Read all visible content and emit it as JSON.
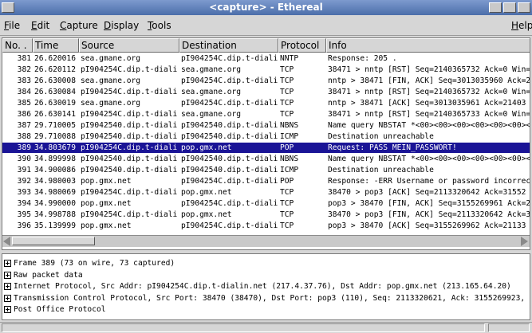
{
  "window": {
    "title": "<capture> - Ethereal"
  },
  "menubar": {
    "items": [
      {
        "pre": "",
        "ul": "F",
        "post": "ile"
      },
      {
        "pre": "",
        "ul": "E",
        "post": "dit"
      },
      {
        "pre": "",
        "ul": "C",
        "post": "apture"
      },
      {
        "pre": "",
        "ul": "D",
        "post": "isplay"
      },
      {
        "pre": "",
        "ul": "T",
        "post": "ools"
      }
    ],
    "help": {
      "pre": "",
      "ul": "H",
      "post": "elp"
    }
  },
  "packet_list": {
    "columns": [
      "No. .",
      "Time",
      "Source",
      "Destination",
      "Protocol",
      "Info"
    ],
    "rows": [
      [
        "381",
        "26.620016",
        "sea.gmane.org",
        "pI904254C.dip.t-diali",
        "NNTP",
        "Response: 205 ."
      ],
      [
        "382",
        "26.620112",
        "pI904254C.dip.t-diali",
        "sea.gmane.org",
        "TCP",
        "38471 > nntp [RST] Seq=2140365732 Ack=0 Win="
      ],
      [
        "383",
        "26.630008",
        "sea.gmane.org",
        "pI904254C.dip.t-diali",
        "TCP",
        "nntp > 38471 [FIN, ACK] Seq=3013035960 Ack=2"
      ],
      [
        "384",
        "26.630084",
        "pI904254C.dip.t-diali",
        "sea.gmane.org",
        "TCP",
        "38471 > nntp [RST] Seq=2140365732 Ack=0 Win="
      ],
      [
        "385",
        "26.630019",
        "sea.gmane.org",
        "pI904254C.dip.t-diali",
        "TCP",
        "nntp > 38471 [ACK] Seq=3013035961 Ack=21403"
      ],
      [
        "386",
        "26.630141",
        "pI904254C.dip.t-diali",
        "sea.gmane.org",
        "TCP",
        "38471 > nntp [RST] Seq=2140365733 Ack=0 Win="
      ],
      [
        "387",
        "29.710005",
        "pI9042540.dip.t-diali",
        "pI9042540.dip.t-diali",
        "NBNS",
        "Name query NBSTAT *<00><00><00><00><00><00><"
      ],
      [
        "388",
        "29.710088",
        "pI9042540.dip.t-diali",
        "pI9042540.dip.t-diali",
        "ICMP",
        "Destination unreachable"
      ],
      [
        "389",
        "34.803679",
        "pI904254C.dip.t-diali",
        "pop.gmx.net",
        "POP",
        "Request: PASS MEIN_PASSWORT!"
      ],
      [
        "390",
        "34.899998",
        "pI9042540.dip.t-diali",
        "pI9042540.dip.t-diali",
        "NBNS",
        "Name query NBSTAT *<00><00><00><00><00><00><"
      ],
      [
        "391",
        "34.900086",
        "pI9042540.dip.t-diali",
        "pI9042540.dip.t-diali",
        "ICMP",
        "Destination unreachable"
      ],
      [
        "392",
        "34.980003",
        "pop.gmx.net",
        "pI904254C.dip.t-diali",
        "POP",
        "Response: -ERR Username or password incorrec"
      ],
      [
        "393",
        "34.980069",
        "pI904254C.dip.t-diali",
        "pop.gmx.net",
        "TCP",
        "38470 > pop3 [ACK] Seq=2113320642 Ack=31552"
      ],
      [
        "394",
        "34.990000",
        "pop.gmx.net",
        "pI904254C.dip.t-diali",
        "TCP",
        "pop3 > 38470 [FIN, ACK] Seq=3155269961 Ack=2"
      ],
      [
        "395",
        "34.998788",
        "pI904254C.dip.t-diali",
        "pop.gmx.net",
        "TCP",
        "38470 > pop3 [FIN, ACK] Seq=2113320642 Ack=3"
      ],
      [
        "396",
        "35.139999",
        "pop.gmx.net",
        "pI904254C.dip.t-diali",
        "TCP",
        "pop3 > 38470 [ACK] Seq=3155269962 Ack=21133"
      ]
    ],
    "selected_row": 8
  },
  "detail_tree": [
    "Frame 389 (73 on wire, 73 captured)",
    "Raw packet data",
    "Internet Protocol, Src Addr: pI904254C.dip.t-dialin.net (217.4.37.76), Dst Addr: pop.gmx.net (213.165.64.20)",
    "Transmission Control Protocol, Src Port: 38470 (38470), Dst Port: pop3 (110), Seq: 2113320621, Ack: 3155269923, L",
    "Post Office Protocol"
  ],
  "colors": {
    "titlebar": "#4b6eaa",
    "selection": "#1a1496"
  }
}
